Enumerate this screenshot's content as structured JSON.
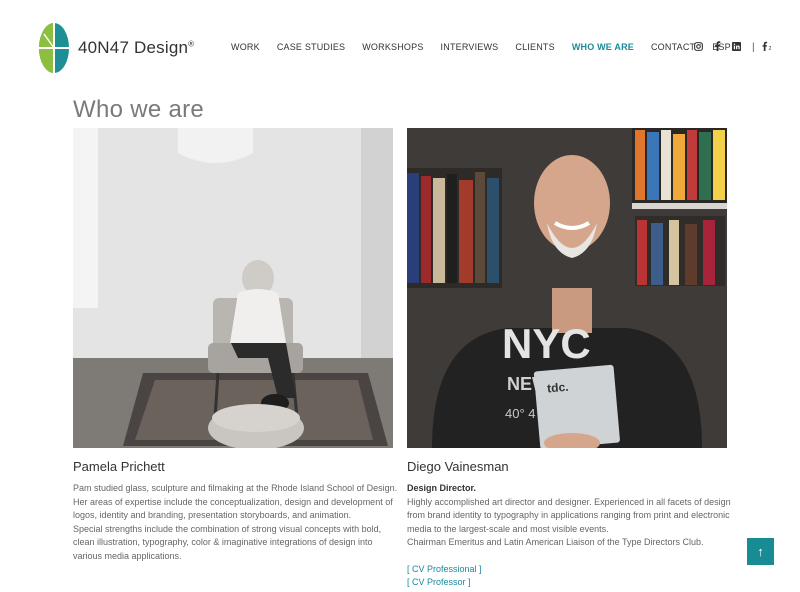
{
  "brand": {
    "name": "40N47 Design",
    "reg_mark": "®",
    "accent": "#1a8a9a"
  },
  "nav": {
    "items": [
      {
        "label": "WORK"
      },
      {
        "label": "CASE STUDIES"
      },
      {
        "label": "WORKSHOPS"
      },
      {
        "label": "INTERVIEWS"
      },
      {
        "label": "CLIENTS"
      },
      {
        "label": "WHO WE ARE",
        "active": true
      },
      {
        "label": "CONTACT"
      },
      {
        "label": "ESP"
      }
    ]
  },
  "social": {
    "icons": [
      "instagram-icon",
      "facebook-icon",
      "linkedin-icon",
      "flickr-icon"
    ]
  },
  "page": {
    "title": "Who we are"
  },
  "people": [
    {
      "name": "Pamela Prichett",
      "bio_lines": [
        "Pam studied glass, sculpture and filmaking at the Rhode Island School of Design. Her areas of expertise include the conceptualization, design and development of logos, identity and branding, presentation storyboards, and animation.",
        "Special strengths include the combination of strong visual concepts with bold, clean illustration, typography, color & imaginative integrations of design into various media applications."
      ]
    },
    {
      "name": "Diego Vainesman",
      "role": "Design Director.",
      "bio_lines": [
        "Highly accomplished art director and designer. Experienced in all facets of design from brand identity to typography in applications ranging from print and electronic media to the largest-scale and most visible events.",
        "Chairman Emeritus and Latin American Liaison of the Type Directors Club."
      ],
      "links": [
        "[ CV Professional ]",
        "[ CV Professor ]"
      ],
      "shirt_text": "NYC",
      "shirt_sub": "NEW YORK",
      "shirt_coords": "40° 4  0' W",
      "award_text": "tdc."
    }
  ],
  "back_to_top": "↑"
}
